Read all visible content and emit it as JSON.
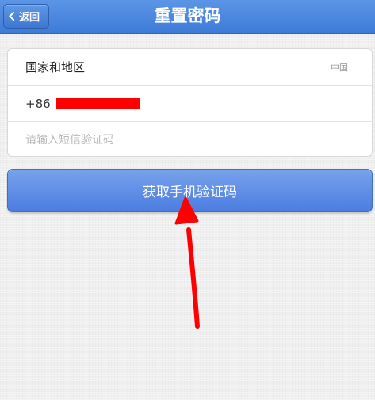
{
  "header": {
    "back_label": "返回",
    "title": "重置密码",
    "color": "#4a86dc"
  },
  "form": {
    "country_label": "国家和地区",
    "country_value": "中国",
    "phone_prefix": "+86",
    "code_placeholder": "请输入短信验证码"
  },
  "actions": {
    "get_code_label": "获取手机验证码",
    "button_color": "#5c8de6"
  },
  "annotation": {
    "arrow_color": "#ff0000"
  }
}
